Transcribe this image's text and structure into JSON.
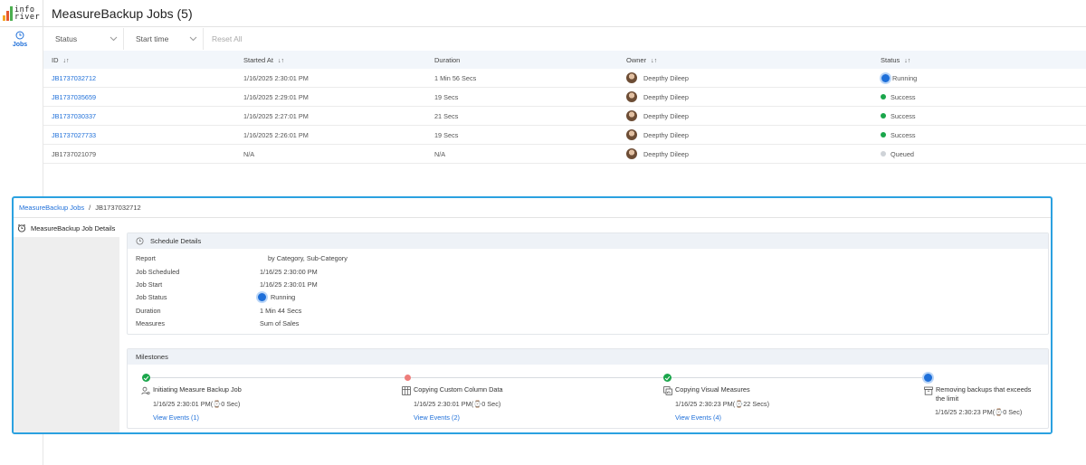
{
  "app": {
    "logo_line1": "info",
    "logo_line2": "river",
    "title": "MeasureBackup Jobs (5)"
  },
  "sidebar": {
    "jobs_label": "Jobs"
  },
  "filters": {
    "status": "Status",
    "start_time": "Start time",
    "reset": "Reset All"
  },
  "table": {
    "headers": {
      "id": "ID",
      "started_at": "Started At",
      "duration": "Duration",
      "owner": "Owner",
      "status": "Status"
    },
    "rows": [
      {
        "id": "JB1737032712",
        "started_at": "1/16/2025 2:30:01 PM",
        "duration": "1 Min 56 Secs",
        "owner": "Deepthy Dileep",
        "status": "Running",
        "status_kind": "running",
        "id_link": true
      },
      {
        "id": "JB1737035659",
        "started_at": "1/16/2025 2:29:01 PM",
        "duration": "19 Secs",
        "owner": "Deepthy Dileep",
        "status": "Success",
        "status_kind": "success",
        "id_link": true
      },
      {
        "id": "JB1737030337",
        "started_at": "1/16/2025 2:27:01 PM",
        "duration": "21 Secs",
        "owner": "Deepthy Dileep",
        "status": "Success",
        "status_kind": "success",
        "id_link": true
      },
      {
        "id": "JB1737027733",
        "started_at": "1/16/2025 2:26:01 PM",
        "duration": "19 Secs",
        "owner": "Deepthy Dileep",
        "status": "Success",
        "status_kind": "success",
        "id_link": true
      },
      {
        "id": "JB1737021079",
        "started_at": "N/A",
        "duration": "N/A",
        "owner": "Deepthy Dileep",
        "status": "Queued",
        "status_kind": "queued",
        "id_link": false
      }
    ]
  },
  "details": {
    "breadcrumb_root": "MeasureBackup Jobs",
    "breadcrumb_separator": "/",
    "breadcrumb_current": "JB1737032712",
    "side_title": "MeasureBackup Job Details",
    "schedule": {
      "title": "Schedule Details",
      "rows": [
        {
          "label": "Report",
          "value": "by Category, Sub-Category"
        },
        {
          "label": "Job Scheduled",
          "value": "1/16/25 2:30:00 PM"
        },
        {
          "label": "Job Start",
          "value": "1/16/25 2:30:01 PM"
        },
        {
          "label": "Job Status",
          "value": "Running"
        },
        {
          "label": "Duration",
          "value": "1 Min 44 Secs"
        },
        {
          "label": "Measures",
          "value": "Sum of Sales"
        }
      ]
    },
    "milestones": {
      "title": "Milestones",
      "items": [
        {
          "title": "Initiating Measure Backup Job",
          "time": "1/16/25 2:30:01 PM(⌚0 Sec)",
          "link": "View Events (1)",
          "state": "done",
          "icon": "user-settings-icon"
        },
        {
          "title": "Copying Custom Column Data",
          "time": "1/16/25 2:30:01 PM(⌚0 Sec)",
          "link": "View Events (2)",
          "state": "error",
          "icon": "table-columns-icon"
        },
        {
          "title": "Copying Visual Measures",
          "time": "1/16/25 2:30:23 PM(⌚22 Secs)",
          "link": "View Events (4)",
          "state": "done",
          "icon": "visual-measures-icon"
        },
        {
          "title": "Removing backups that exceeds the limit",
          "time": "1/16/25 2:30:23 PM(⌚0 Sec)",
          "link": "",
          "state": "running",
          "icon": "archive-icon"
        }
      ]
    }
  },
  "colors": {
    "accent": "#1e6fd9",
    "success": "#1aa64b",
    "error": "#ee7d7a",
    "queued": "#cfd3d8",
    "panel_border": "#2ba1e0"
  }
}
